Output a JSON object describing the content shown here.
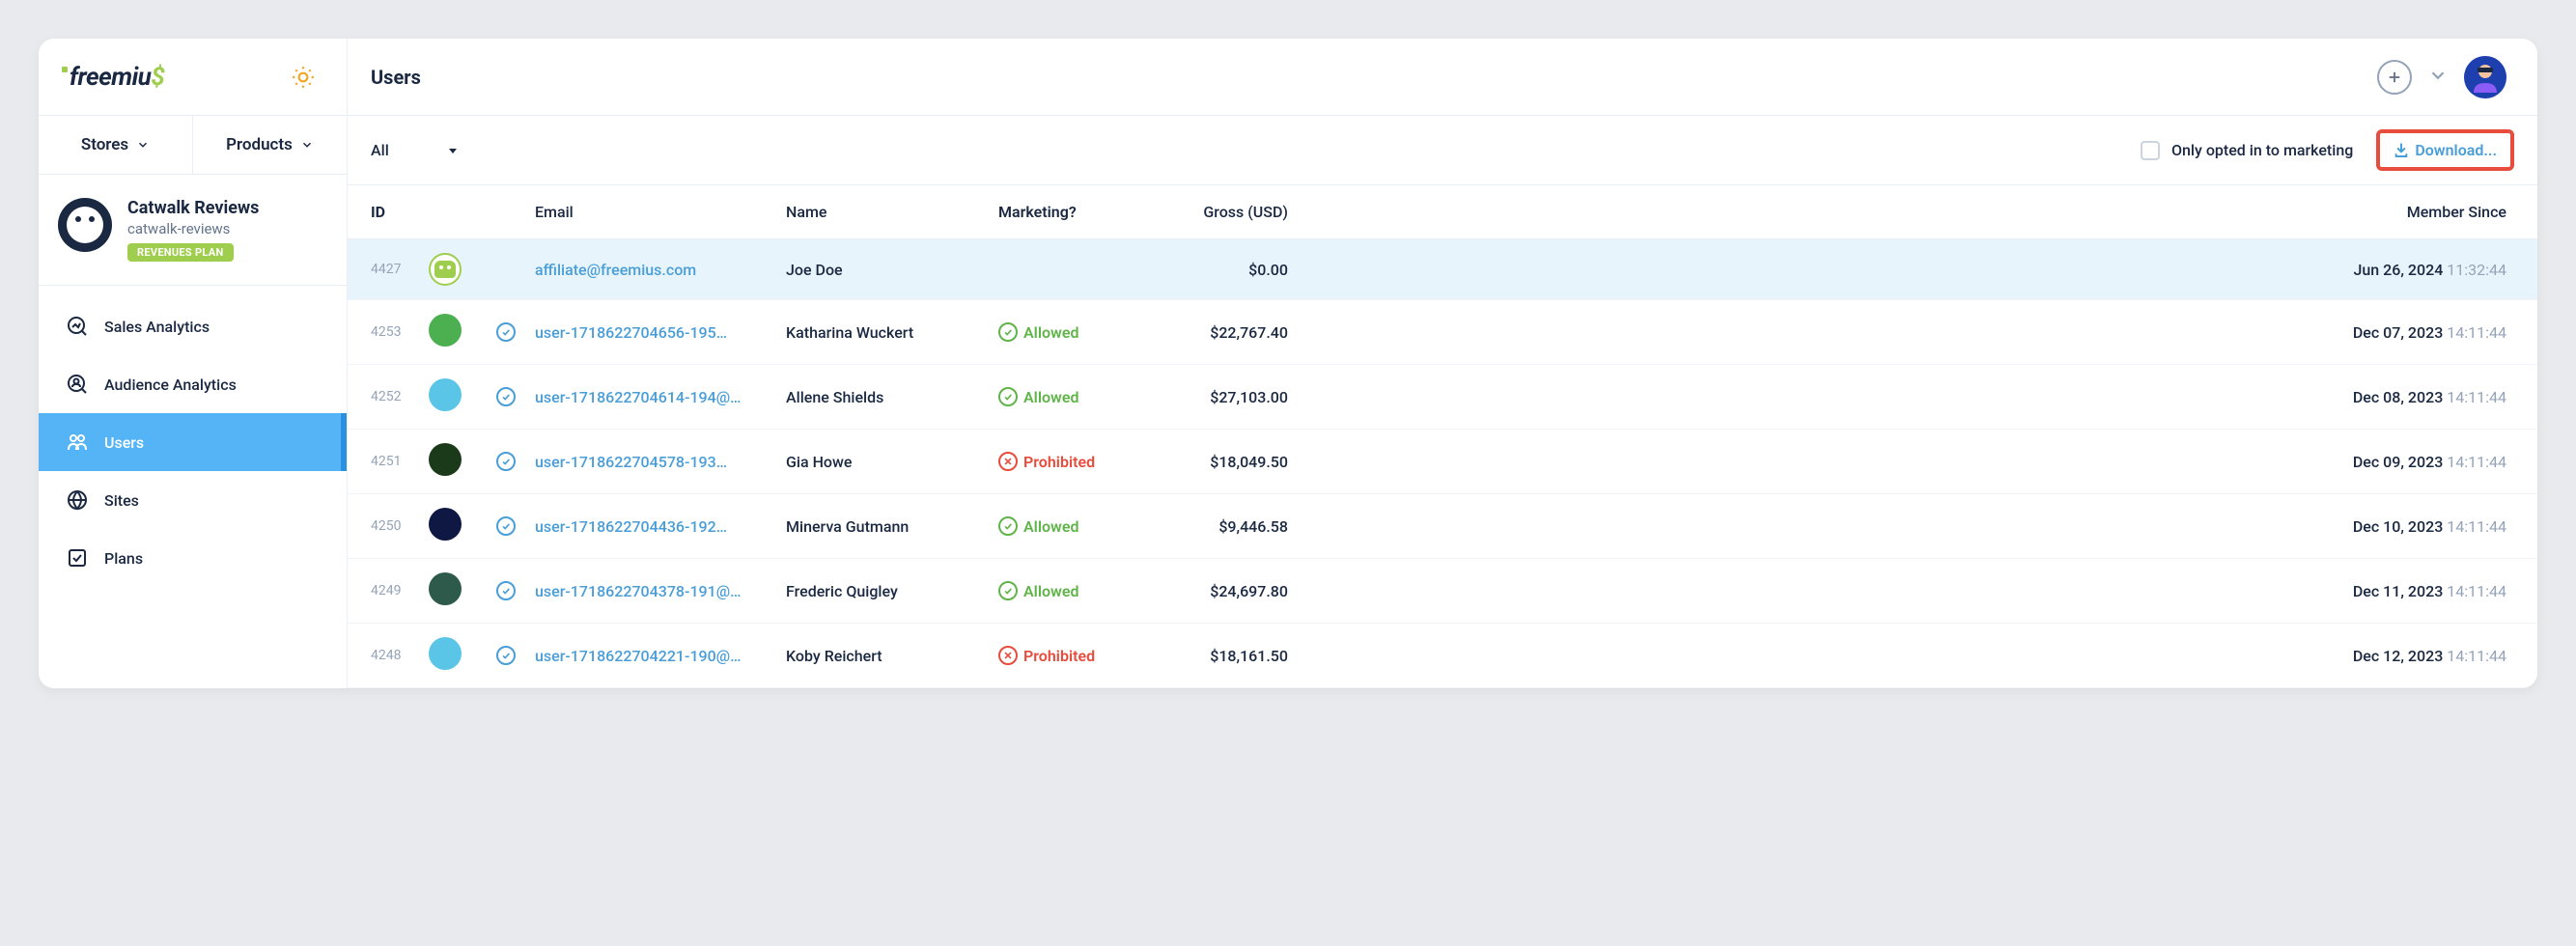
{
  "header": {
    "title": "Users",
    "logo_text": "freemiu",
    "logo_dollar": "$"
  },
  "nav": {
    "stores": "Stores",
    "products": "Products"
  },
  "product": {
    "title": "Catwalk Reviews",
    "slug": "catwalk-reviews",
    "badge": "REVENUES PLAN"
  },
  "sidebar": {
    "items": [
      {
        "label": "Sales Analytics",
        "icon": "chart"
      },
      {
        "label": "Audience Analytics",
        "icon": "audience"
      },
      {
        "label": "Users",
        "icon": "users",
        "active": true
      },
      {
        "label": "Sites",
        "icon": "globe"
      },
      {
        "label": "Plans",
        "icon": "plans"
      }
    ]
  },
  "toolbar": {
    "filter": "All",
    "checkbox_label": "Only opted in to marketing",
    "download_label": "Download..."
  },
  "table": {
    "headers": {
      "id": "ID",
      "email": "Email",
      "name": "Name",
      "marketing": "Marketing?",
      "gross": "Gross (USD)",
      "member": "Member Since"
    },
    "rows": [
      {
        "id": "4427",
        "avatar_type": "robot",
        "avatar_bg": "",
        "verified": false,
        "email": "affiliate@freemius.com",
        "name": "Joe Doe",
        "marketing": "",
        "marketing_type": "",
        "gross": "$0.00",
        "date": "Jun 26, 2024",
        "time": "11:32:44",
        "highlighted": true
      },
      {
        "id": "4253",
        "avatar_type": "circle",
        "avatar_bg": "#4caf50",
        "verified": true,
        "email": "user-1718622704656-195…",
        "name": "Katharina Wuckert",
        "marketing": "Allowed",
        "marketing_type": "allowed",
        "gross": "$22,767.40",
        "date": "Dec 07, 2023",
        "time": "14:11:44",
        "highlighted": false
      },
      {
        "id": "4252",
        "avatar_type": "circle",
        "avatar_bg": "#5bc5e8",
        "verified": true,
        "email": "user-1718622704614-194@…",
        "name": "Allene Shields",
        "marketing": "Allowed",
        "marketing_type": "allowed",
        "gross": "$27,103.00",
        "date": "Dec 08, 2023",
        "time": "14:11:44",
        "highlighted": false
      },
      {
        "id": "4251",
        "avatar_type": "circle",
        "avatar_bg": "#1a3a1a",
        "verified": true,
        "email": "user-1718622704578-193…",
        "name": "Gia Howe",
        "marketing": "Prohibited",
        "marketing_type": "prohibited",
        "gross": "$18,049.50",
        "date": "Dec 09, 2023",
        "time": "14:11:44",
        "highlighted": false
      },
      {
        "id": "4250",
        "avatar_type": "circle",
        "avatar_bg": "#0f1842",
        "verified": true,
        "email": "user-1718622704436-192…",
        "name": "Minerva Gutmann",
        "marketing": "Allowed",
        "marketing_type": "allowed",
        "gross": "$9,446.58",
        "date": "Dec 10, 2023",
        "time": "14:11:44",
        "highlighted": false
      },
      {
        "id": "4249",
        "avatar_type": "circle",
        "avatar_bg": "#2d5a4a",
        "verified": true,
        "email": "user-1718622704378-191@…",
        "name": "Frederic Quigley",
        "marketing": "Allowed",
        "marketing_type": "allowed",
        "gross": "$24,697.80",
        "date": "Dec 11, 2023",
        "time": "14:11:44",
        "highlighted": false
      },
      {
        "id": "4248",
        "avatar_type": "circle",
        "avatar_bg": "#5bc5e8",
        "verified": true,
        "email": "user-1718622704221-190@…",
        "name": "Koby Reichert",
        "marketing": "Prohibited",
        "marketing_type": "prohibited",
        "gross": "$18,161.50",
        "date": "Dec 12, 2023",
        "time": "14:11:44",
        "highlighted": false
      }
    ]
  }
}
